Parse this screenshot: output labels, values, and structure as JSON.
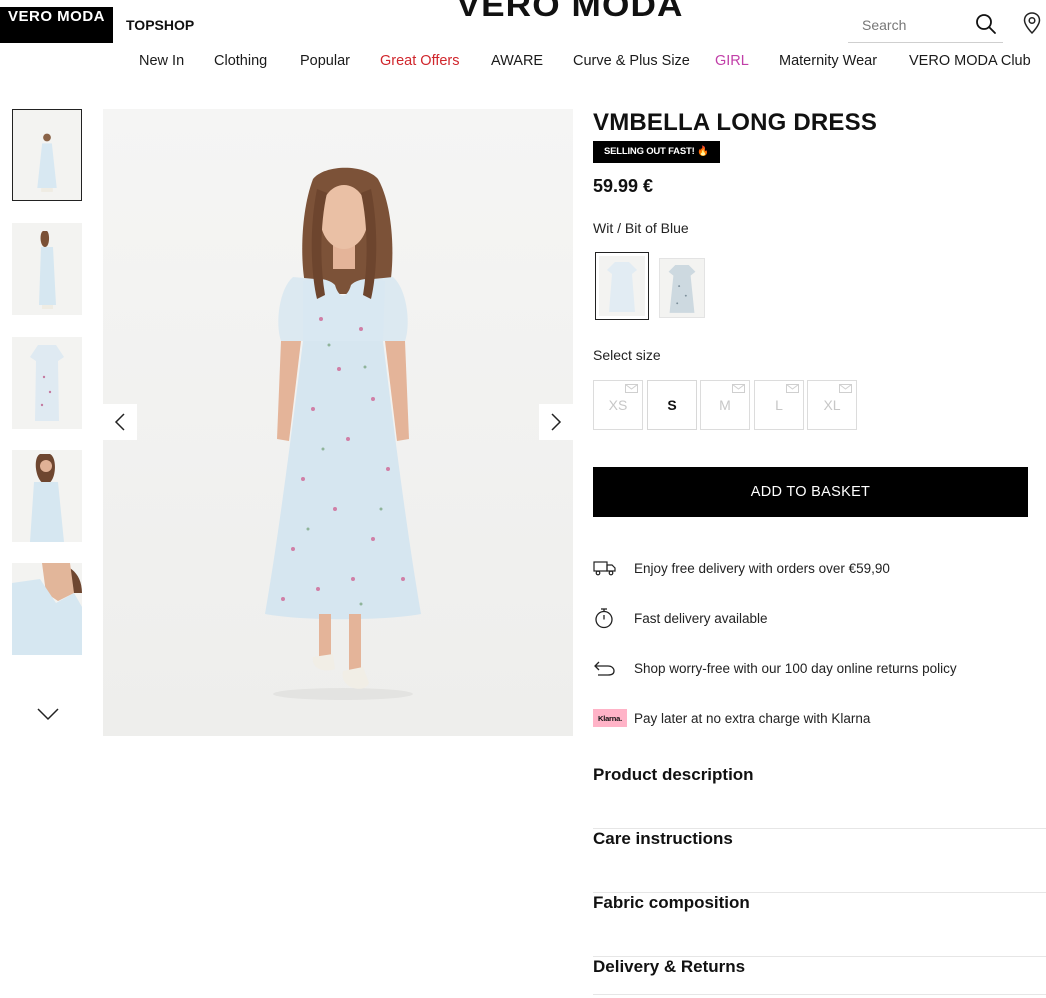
{
  "header": {
    "brand_tabs": [
      "VERO MODA",
      "TOPSHOP"
    ],
    "logo": "VERO MODA",
    "search": {
      "placeholder": "Search"
    },
    "icons": [
      "search-icon",
      "location-pin-icon"
    ]
  },
  "nav": {
    "items": [
      {
        "label": "New In",
        "color": "#1a1a1a"
      },
      {
        "label": "Clothing",
        "color": "#1a1a1a"
      },
      {
        "label": "Popular",
        "color": "#1a1a1a"
      },
      {
        "label": "Great Offers",
        "color": "#d0262c"
      },
      {
        "label": "AWARE",
        "color": "#1a1a1a"
      },
      {
        "label": "Curve & Plus Size",
        "color": "#1a1a1a"
      },
      {
        "label": "GIRL",
        "color": "#c13fa8"
      },
      {
        "label": "Maternity Wear",
        "color": "#1a1a1a"
      },
      {
        "label": "VERO MODA Club",
        "color": "#1a1a1a"
      }
    ]
  },
  "gallery": {
    "thumbnail_count": 5,
    "active_thumbnail": 1,
    "icons": [
      "chevron-up-icon",
      "chevron-down-icon",
      "chevron-left-icon",
      "chevron-right-icon"
    ]
  },
  "product": {
    "title": "VMBELLA LONG DRESS",
    "badge": "SELLING OUT FAST! 🔥",
    "price": "59.99 €",
    "color_label": "Wit / Bit of Blue",
    "swatches": [
      {
        "name": "Wit / Bit of Blue",
        "selected": true
      },
      {
        "name": "alternate colour",
        "selected": false
      }
    ],
    "size_label": "Select size",
    "sizes": [
      {
        "label": "XS",
        "available": false
      },
      {
        "label": "S",
        "available": true
      },
      {
        "label": "M",
        "available": false
      },
      {
        "label": "L",
        "available": false
      },
      {
        "label": "XL",
        "available": false
      }
    ],
    "add_to_basket": "ADD TO BASKET",
    "benefits": [
      {
        "icon": "delivery-truck-icon",
        "text": "Enjoy free delivery with orders over €59,90"
      },
      {
        "icon": "stopwatch-icon",
        "text": "Fast delivery available"
      },
      {
        "icon": "return-arrow-icon",
        "text": "Shop worry-free with our 100 day online returns policy"
      },
      {
        "icon": "klarna-logo",
        "logo_text": "Klarna.",
        "text": "Pay later at no extra charge with Klarna"
      }
    ],
    "accordions": [
      "Product description",
      "Care instructions",
      "Fabric composition",
      "Delivery & Returns"
    ]
  },
  "colors": {
    "accent_sale": "#d0262c",
    "accent_girl": "#c13fa8",
    "klarna_pink": "#ffb3c7",
    "dress_blue": "#dbe9f3"
  }
}
